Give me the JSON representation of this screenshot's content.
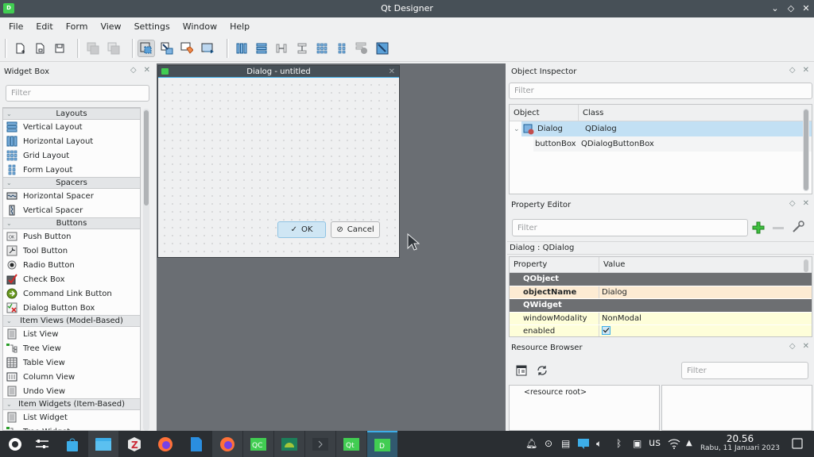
{
  "window": {
    "title": "Qt Designer",
    "app_icon_letter": "D",
    "controls": {
      "minimize": "⌄",
      "maximize": "◇",
      "close": "✕"
    }
  },
  "menu": [
    "File",
    "Edit",
    "Form",
    "View",
    "Settings",
    "Window",
    "Help"
  ],
  "toolbar": {
    "file": [
      "new-form",
      "open-form",
      "save-form"
    ],
    "edit": [
      "send-to-back",
      "bring-to-front"
    ],
    "modes": [
      "edit-widgets",
      "edit-signals-slots",
      "edit-buddies",
      "edit-tab-order"
    ],
    "layout": [
      "lay-out-horizontally",
      "lay-out-vertically",
      "lay-out-horizontally-splitter",
      "lay-out-vertically-splitter",
      "lay-out-grid",
      "lay-out-form",
      "break-layout",
      "adjust-size"
    ]
  },
  "widget_box": {
    "title": "Widget Box",
    "filter_placeholder": "Filter",
    "categories": [
      {
        "label": "Layouts",
        "items": [
          {
            "label": "Vertical Layout",
            "icon": "vertical-layout-icon"
          },
          {
            "label": "Horizontal Layout",
            "icon": "horizontal-layout-icon"
          },
          {
            "label": "Grid Layout",
            "icon": "grid-layout-icon"
          },
          {
            "label": "Form Layout",
            "icon": "form-layout-icon"
          }
        ]
      },
      {
        "label": "Spacers",
        "items": [
          {
            "label": "Horizontal Spacer",
            "icon": "horizontal-spacer-icon"
          },
          {
            "label": "Vertical Spacer",
            "icon": "vertical-spacer-icon"
          }
        ]
      },
      {
        "label": "Buttons",
        "items": [
          {
            "label": "Push Button",
            "icon": "push-button-icon"
          },
          {
            "label": "Tool Button",
            "icon": "tool-button-icon"
          },
          {
            "label": "Radio Button",
            "icon": "radio-button-icon"
          },
          {
            "label": "Check Box",
            "icon": "check-box-icon"
          },
          {
            "label": "Command Link Button",
            "icon": "command-link-icon"
          },
          {
            "label": "Dialog Button Box",
            "icon": "dialog-button-box-icon"
          }
        ]
      },
      {
        "label": "Item Views (Model-Based)",
        "items": [
          {
            "label": "List View",
            "icon": "list-view-icon"
          },
          {
            "label": "Tree View",
            "icon": "tree-view-icon"
          },
          {
            "label": "Table View",
            "icon": "table-view-icon"
          },
          {
            "label": "Column View",
            "icon": "column-view-icon"
          },
          {
            "label": "Undo View",
            "icon": "undo-view-icon"
          }
        ]
      },
      {
        "label": "Item Widgets (Item-Based)",
        "items": [
          {
            "label": "List Widget",
            "icon": "list-widget-icon"
          },
          {
            "label": "Tree Widget",
            "icon": "tree-widget-icon"
          }
        ]
      }
    ]
  },
  "form": {
    "title": "Dialog - untitled",
    "ok_label": "OK",
    "cancel_label": "Cancel"
  },
  "object_inspector": {
    "title": "Object Inspector",
    "filter_placeholder": "Filter",
    "columns": [
      "Object",
      "Class"
    ],
    "rows": [
      {
        "object": "Dialog",
        "class": "QDialog",
        "selected": true
      },
      {
        "object": "buttonBox",
        "class": "QDialogButtonBox",
        "selected": false
      }
    ]
  },
  "property_editor": {
    "title": "Property Editor",
    "filter_placeholder": "Filter",
    "context": "Dialog : QDialog",
    "columns": [
      "Property",
      "Value"
    ],
    "rows": [
      {
        "type": "group",
        "name": "QObject"
      },
      {
        "type": "prop",
        "name": "objectName",
        "value": "Dialog",
        "bold": true,
        "bg": "#fdebd3"
      },
      {
        "type": "group",
        "name": "QWidget"
      },
      {
        "type": "prop",
        "name": "windowModality",
        "value": "NonModal",
        "bg": "#fefed9"
      },
      {
        "type": "prop",
        "name": "enabled",
        "value": "",
        "checked": true,
        "bg": "#fefed9"
      }
    ]
  },
  "resource_browser": {
    "title": "Resource Browser",
    "filter_placeholder": "Filter",
    "root_label": "<resource root>"
  },
  "taskbar": {
    "apps": [
      "application-launcher",
      "system-settings",
      "discover",
      "dolphin-files",
      "zotero",
      "firefox",
      "libreoffice-writer",
      "firefox-running",
      "qt-creator",
      "android-studio",
      "konsole",
      "qt-assistant",
      "qt-designer"
    ],
    "tray": {
      "keyboard_layout": "us"
    },
    "clock": {
      "time": "20.56",
      "date": "Rabu, 11 Januari 2023"
    }
  },
  "colors": {
    "accent": "#3daee9",
    "titlebar": "#475057",
    "mdi_bg": "#6a6e73",
    "qt_green": "#41cd52"
  }
}
